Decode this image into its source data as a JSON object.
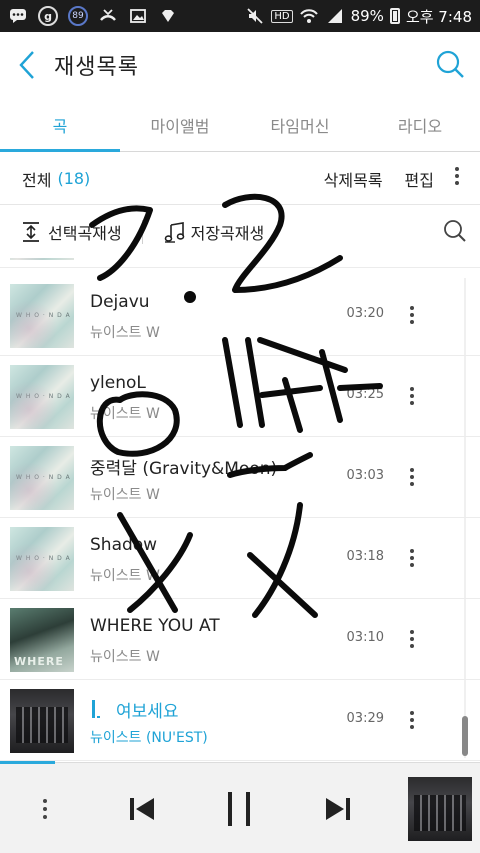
{
  "status_bar": {
    "icons": [
      "chat-icon",
      "g-circle-icon",
      "badge-89-icon",
      "missed-call-icon",
      "image-icon",
      "diamond-icon",
      "mute-icon",
      "hd-icon",
      "wifi-icon",
      "signal-icon",
      "battery-icon"
    ],
    "badge": "89",
    "hd": "HD",
    "battery": "89%",
    "time": "오후 7:48"
  },
  "header": {
    "title": "재생목록"
  },
  "tabs": [
    {
      "label": "곡",
      "active": true
    },
    {
      "label": "마이앨범",
      "active": false
    },
    {
      "label": "타임머신",
      "active": false
    },
    {
      "label": "라디오",
      "active": false
    }
  ],
  "toolbar": {
    "all_label": "전체",
    "count": "(18)",
    "delete_list": "삭제목록",
    "edit": "편집"
  },
  "play_row": {
    "play_selected": "선택곡재생",
    "play_saved": "저장곡재생"
  },
  "songs": [
    {
      "title": "Dejavu",
      "artist": "뉴이스트 W",
      "duration": "03:20",
      "art": "pastel"
    },
    {
      "title": "ylenoL",
      "artist": "뉴이스트 W",
      "duration": "03:25",
      "art": "pastel"
    },
    {
      "title": "중력달 (Gravity&Moon)",
      "artist": "뉴이스트 W",
      "duration": "03:03",
      "art": "pastel"
    },
    {
      "title": "Shadow",
      "artist": "뉴이스트 W",
      "duration": "03:18",
      "art": "pastel"
    },
    {
      "title": "WHERE YOU AT",
      "artist": "뉴이스트 W",
      "duration": "03:10",
      "art": "green"
    },
    {
      "title": "여보세요",
      "artist": "뉴이스트 (NU'EST)",
      "duration": "03:29",
      "art": "dark",
      "playing": true
    }
  ],
  "player": {
    "progress": 0.115
  },
  "colors": {
    "accent": "#1fa3d6",
    "status_bar": "#1c1c1c",
    "player_bg": "#f2f2f2"
  }
}
